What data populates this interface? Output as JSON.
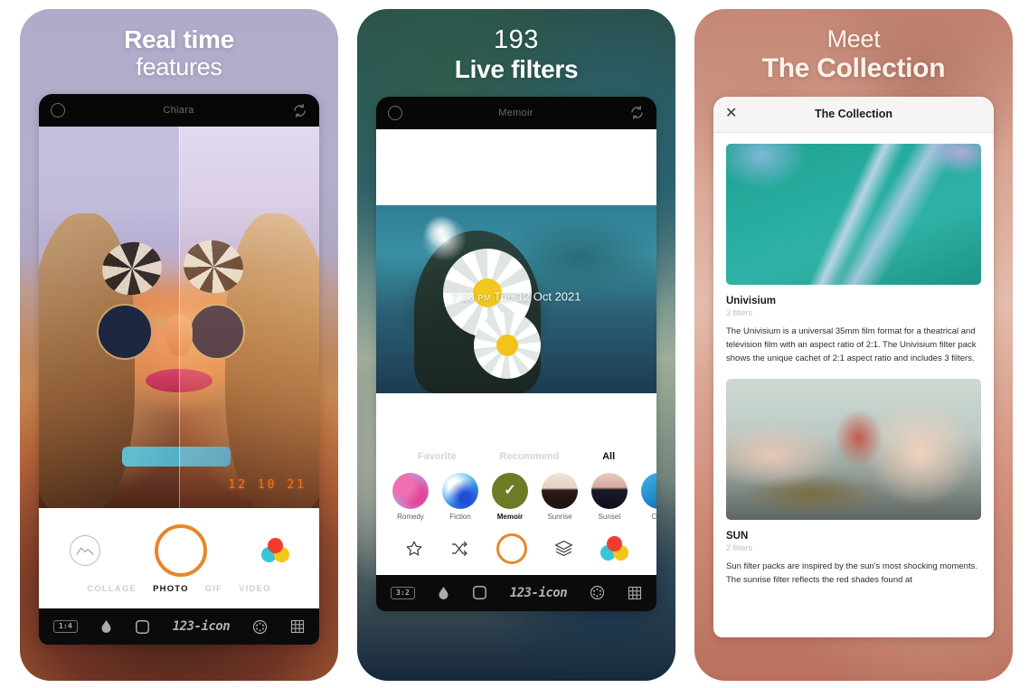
{
  "panels": [
    {
      "headline_line1": "Real time",
      "headline_line2": "features",
      "appbar": {
        "title": "Chiara",
        "left_icon": "circle-ring-icon",
        "right_icon": "flip-camera-icon"
      },
      "viewport": {
        "datestamp": "12 10 21"
      },
      "controls": {
        "gallery_label": "gallery-icon",
        "shutter_label": "shutter-button",
        "color_label": "color-filter-icon"
      },
      "mode_tabs": [
        {
          "label": "COLLAGE",
          "active": false
        },
        {
          "label": "PHOTO",
          "active": true
        },
        {
          "label": "GIF",
          "active": false
        },
        {
          "label": "VIDEO",
          "active": false
        }
      ],
      "toolbar": {
        "ratio": "1:4",
        "items": [
          "aspect-ratio-badge",
          "droplet-icon",
          "square-icon",
          "123-icon",
          "aperture-icon",
          "grid-icon"
        ]
      }
    },
    {
      "headline_line1": "193",
      "headline_line2": "Live filters",
      "appbar": {
        "title": "Memoir",
        "left_icon": "circle-ring-icon",
        "right_icon": "flip-camera-icon"
      },
      "photo": {
        "timestamp_time": "7:23",
        "timestamp_ampm": "PM",
        "timestamp_date": "Tue 12 Oct 2021"
      },
      "filter_tabs": [
        {
          "label": "Favorite",
          "active": false
        },
        {
          "label": "Recommend",
          "active": false
        },
        {
          "label": "All",
          "active": true
        }
      ],
      "filters": [
        {
          "name": "Romedy",
          "selected": false
        },
        {
          "name": "Fiction",
          "selected": false
        },
        {
          "name": "Memoir",
          "selected": true
        },
        {
          "name": "Sunrise",
          "selected": false
        },
        {
          "name": "Sunset",
          "selected": false
        },
        {
          "name": "Card",
          "selected": false
        }
      ],
      "edit_row": [
        "star-icon",
        "shuffle-icon",
        "shutter-button",
        "layers-icon",
        "color-filter-icon"
      ],
      "toolbar": {
        "ratio": "3:2",
        "items": [
          "aspect-ratio-badge",
          "droplet-icon",
          "square-icon",
          "123-icon",
          "aperture-icon",
          "grid-icon"
        ]
      }
    },
    {
      "headline_line1": "Meet",
      "headline_line2": "The Collection",
      "sheet": {
        "title": "The Collection",
        "close_icon": "close-icon",
        "packs": [
          {
            "name": "Univisium",
            "count": "3 filters",
            "description": "The Univisium is a universal 35mm film format for a theatrical and television film with an aspect ratio of 2:1. The Univisium filter pack shows the unique cachet of 2:1 aspect ratio and includes 3 filters."
          },
          {
            "name": "SUN",
            "count": "2 filters",
            "description": "Sun filter packs are inspired by the sun's most shocking moments. The sunrise filter reflects the red shades found at"
          }
        ]
      }
    }
  ],
  "colors": {
    "accent_orange": "#e8862a",
    "memoir_green": "#6b7b26",
    "cw_red": "#f03c2e",
    "cw_cyan": "#39c4d8",
    "cw_yellow": "#f5c518",
    "sheet_bg": "#f6f5f3",
    "datestamp_orange": "#ff7a1a"
  }
}
